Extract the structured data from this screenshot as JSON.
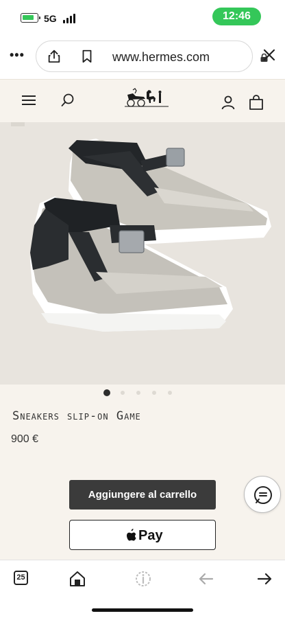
{
  "status_bar": {
    "network": "5G",
    "time": "12:46",
    "battery_level": 0.75,
    "colors": {
      "time_pill": "#34c759",
      "battery": "#35c759"
    }
  },
  "browser": {
    "url": "www.hermes.com",
    "menu_icon": "more-horizontal-icon",
    "share_icon": "share-icon",
    "bookmark_icon": "bookmark-icon",
    "lock_icon": "lock-icon",
    "close_icon": "close-icon"
  },
  "site_header": {
    "menu_icon": "hamburger-menu-icon",
    "search_icon": "search-icon",
    "logo": "hermes-carriage-logo",
    "account_icon": "user-icon",
    "bag_icon": "shopping-bag-icon"
  },
  "product": {
    "title": "Sneakers slip-on Game",
    "price": "900 €",
    "image": "slip-on-sneakers-photo",
    "carousel": {
      "count": 5,
      "active_index": 0
    }
  },
  "actions": {
    "add_to_cart": "Aggiungere al carrello",
    "apple_pay": "Pay",
    "chat_icon": "chat-bubble-icon"
  },
  "toolbar": {
    "tab_count": "25",
    "home_icon": "home-icon",
    "info_icon": "info-icon",
    "back_icon": "arrow-left-icon",
    "forward_icon": "arrow-right-icon"
  },
  "theme": {
    "page_background": "#f7f3ed",
    "button_dark": "#3b3b3b"
  }
}
